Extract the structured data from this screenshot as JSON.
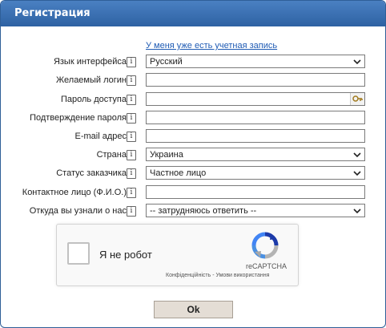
{
  "header": {
    "title": "Регистрация"
  },
  "have_account_link": "У меня уже есть учетная запись",
  "info_glyph": "i",
  "form": {
    "language": {
      "label": "Язык интерфейса",
      "value": "Русский"
    },
    "login": {
      "label": "Желаемый логин",
      "value": ""
    },
    "password": {
      "label": "Пароль доступа",
      "value": ""
    },
    "password_confirm": {
      "label": "Подтверждение пароля",
      "value": ""
    },
    "email": {
      "label": "E-mail адрес",
      "value": ""
    },
    "country": {
      "label": "Страна",
      "value": "Украина"
    },
    "customer_status": {
      "label": "Статус заказчика",
      "value": "Частное лицо"
    },
    "contact_person": {
      "label": "Контактное лицо (Ф.И.О.)",
      "value": ""
    },
    "referral": {
      "label": "Откуда вы узнали о нас",
      "value": "-- затрудняюсь ответить --"
    }
  },
  "captcha": {
    "label": "Я не робот",
    "brand": "reCAPTCHA",
    "privacy": "Конфіденційність",
    "separator": " - ",
    "terms": "Умови використання"
  },
  "submit": {
    "label": "Ok"
  },
  "colors": {
    "header": "#3a6fb0",
    "link": "#1f5bb4",
    "button": "#e4ddd5"
  },
  "icons": [
    "info-icon",
    "chevron-down-icon",
    "key-icon",
    "recaptcha-logo-icon"
  ]
}
